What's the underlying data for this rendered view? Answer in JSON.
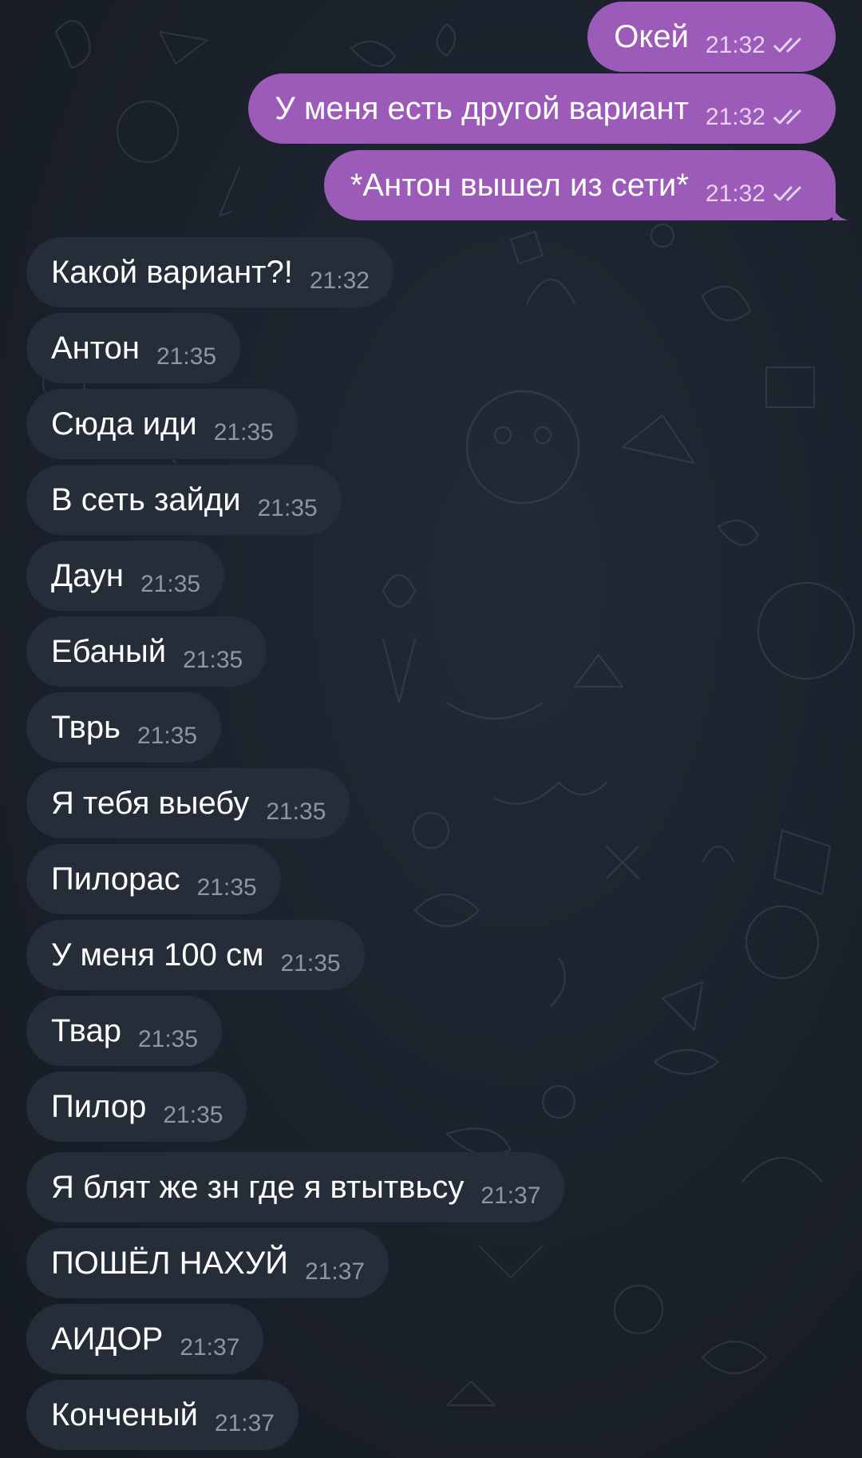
{
  "chat": {
    "colors": {
      "background": "#1b212b",
      "outgoing_bubble": "#9c5bb8",
      "incoming_bubble": "#252d39",
      "incoming_time": "#8d96a6",
      "outgoing_time": "#e7d2ef"
    },
    "outgoing": [
      {
        "text": "Окей",
        "time": "21:32",
        "status": "double-check-icon"
      },
      {
        "text": "У меня есть другой вариант",
        "time": "21:32",
        "status": "double-check-icon"
      },
      {
        "text": "*Антон вышел из сети*",
        "time": "21:32",
        "status": "double-check-icon"
      }
    ],
    "incoming": [
      {
        "text": "Какой вариант?!",
        "time": "21:32"
      },
      {
        "text": "Антон",
        "time": "21:35"
      },
      {
        "text": "Сюда иди",
        "time": "21:35"
      },
      {
        "text": "В сеть зайди",
        "time": "21:35"
      },
      {
        "text": "Даун",
        "time": "21:35"
      },
      {
        "text": "Ебаный",
        "time": "21:35"
      },
      {
        "text": "Тврь",
        "time": "21:35"
      },
      {
        "text": "Я тебя выебу",
        "time": "21:35"
      },
      {
        "text": "Пилорас",
        "time": "21:35"
      },
      {
        "text": "У меня 100 см",
        "time": "21:35"
      },
      {
        "text": "Твар",
        "time": "21:35"
      },
      {
        "text": "Пилор",
        "time": "21:35"
      },
      {
        "text": "Я блят же зн где я втытвьсу",
        "time": "21:37"
      },
      {
        "text": "ПОШЁЛ НАХУЙ",
        "time": "21:37"
      },
      {
        "text": "АИДОР",
        "time": "21:37"
      },
      {
        "text": "Конченый",
        "time": "21:37"
      }
    ]
  }
}
